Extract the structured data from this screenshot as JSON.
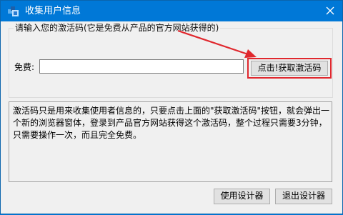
{
  "window": {
    "title": "收集用户信息"
  },
  "activation": {
    "group_caption": "请输入您的激活码(它是免费从产品的官方网站获得的)",
    "field_label": "免费:",
    "input_value": "",
    "get_code_label": "点击!获取激活码"
  },
  "description": {
    "lines": [
      "激活码只是用来收集使用者信息的，只要点击上面的\"获取激活码\"按钮，就会弹出一",
      "个新的浏览器窗体，登录到产品官方网站获得这个激活码，整个过程只需要3分钟，",
      "只需要操作一次，而且完全免费。"
    ]
  },
  "footer": {
    "use_label": "使用设计器",
    "exit_label": "退出设计器"
  },
  "annotation": {
    "color": "#e0282e"
  },
  "colors": {
    "titlebar": "#0078d7",
    "window_bg": "#f0f0f0"
  }
}
